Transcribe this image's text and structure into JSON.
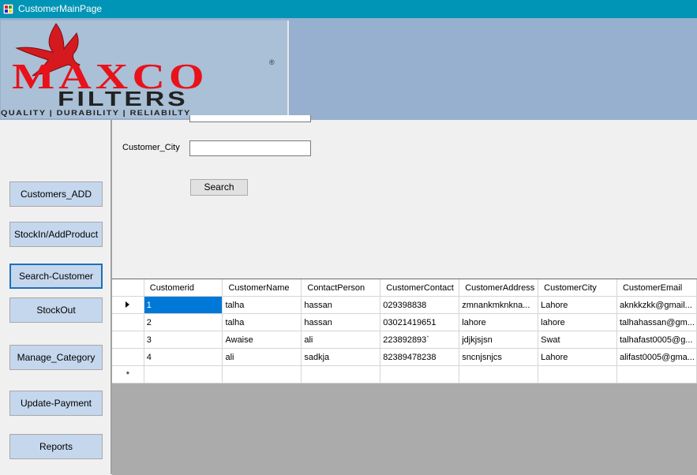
{
  "window": {
    "title": "CustomerMainPage"
  },
  "logo": {
    "brand": "MAXCO",
    "product": "FILTERS",
    "tagline": "QUALITY | DURABILITY | RELIABILTY",
    "registered": "®"
  },
  "nav": {
    "customers_add": "Customers_ADD",
    "stock_in": "StockIn/AddProduct",
    "search_customer": "Search-Customer",
    "stock_out": "StockOut",
    "manage_category": "Manage_Category",
    "update_payment": "Update-Payment",
    "reports": "Reports"
  },
  "search": {
    "city_label": "Customer_City",
    "city_value": "",
    "button": "Search"
  },
  "grid": {
    "columns": [
      "Customerid",
      "CustomerName",
      "ContactPerson",
      "CustomerContact",
      "CustomerAddress",
      "CustomerCity",
      "CustomerEmail"
    ],
    "rows": [
      [
        "1",
        "talha",
        "hassan",
        "029398838",
        "zmnankmknkna...",
        "Lahore",
        "aknkkzkk@gmail..."
      ],
      [
        "2",
        "talha",
        "hassan",
        "03021419651",
        "lahore",
        "lahore",
        "talhahassan@gm..."
      ],
      [
        "3",
        "Awaise",
        "ali",
        "223892893`",
        "jdjkjsjsn",
        "Swat",
        "talhafast0005@g..."
      ],
      [
        "4",
        "ali",
        "sadkja",
        "82389478238",
        "sncnjsnjcs",
        "Lahore",
        "alifast0005@gma..."
      ]
    ],
    "new_row_marker": "*"
  },
  "colors": {
    "titlebar": "#0095b6",
    "header_panel": "#98b0d0",
    "nav_button": "#c5d7ed",
    "selection": "#0078d7"
  }
}
